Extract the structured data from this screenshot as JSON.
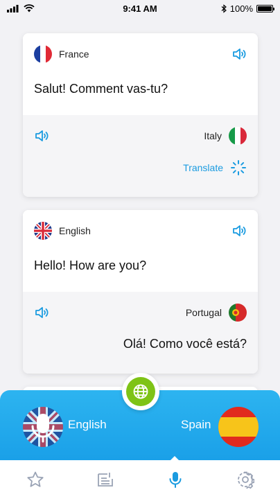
{
  "status": {
    "time": "9:41 AM",
    "battery": "100%"
  },
  "cards": [
    {
      "source_lang": "France",
      "source_text": "Salut! Comment vas-tu?",
      "target_lang": "Italy",
      "action": "Translate"
    },
    {
      "source_lang": "English",
      "source_text": "Hello! How are you?",
      "target_lang": "Portugal",
      "target_text": "Olá! Como você está?"
    }
  ],
  "panel": {
    "from_lang": "English",
    "to_lang": "Spain"
  },
  "colors": {
    "accent": "#1a9be0",
    "panel": "#2db4f0",
    "globe": "#7ec316"
  },
  "tabs": [
    "favorites-icon",
    "history-icon",
    "microphone-icon",
    "settings-icon"
  ]
}
